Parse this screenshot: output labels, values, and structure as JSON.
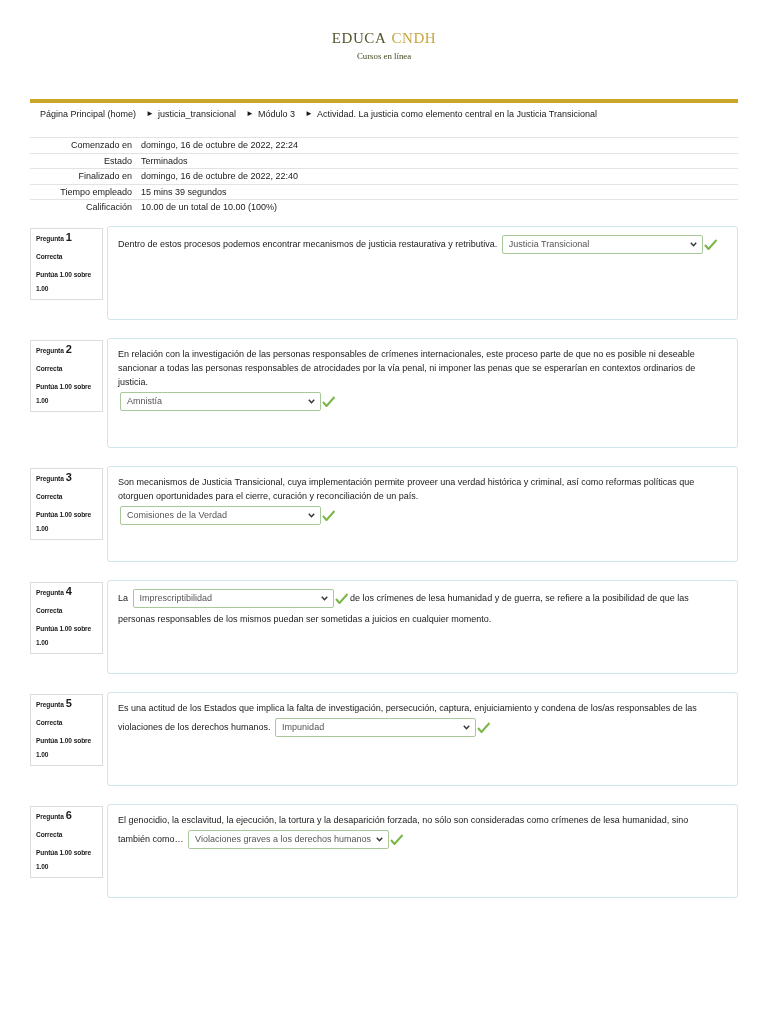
{
  "header": {
    "title": [
      {
        "kind": "primary",
        "text": "EDUCA"
      },
      {
        "kind": "accent",
        "text": "CNDH"
      }
    ],
    "subtitle": "Cursos en línea"
  },
  "breadcrumb": [
    {
      "text": "Página Principal (home)"
    },
    {
      "separator": "►",
      "text": "justicia_transicional"
    },
    {
      "separator": "►",
      "text": "Módulo 3"
    },
    {
      "separator": "►",
      "text": "Actividad. La justicia como elemento central en la Justicia Transicional"
    }
  ],
  "summary": [
    {
      "label": "Comenzado en",
      "value": "domingo, 16 de octubre de 2022, 22:24"
    },
    {
      "label": "Estado",
      "value": "Terminados"
    },
    {
      "label": "Finalizado en",
      "value": "domingo, 16 de octubre de 2022, 22:40"
    },
    {
      "label": "Tiempo empleado",
      "value": "15 mins 39 segundos"
    },
    {
      "label": "Calificación",
      "value": "10.00 de un total de 10.00 (100%)"
    }
  ],
  "questions": [
    {
      "label": "Pregunta",
      "number": "1",
      "status": "Correcta",
      "grade": "Puntúa 1.00 sobre 1.00",
      "parts": [
        {
          "kind": "text",
          "text": "Dentro de estos procesos podemos encontrar mecanismos de justicia restaurativa y retributiva."
        },
        {
          "kind": "answer",
          "value": "Justicia Transicional",
          "correct": true
        }
      ]
    },
    {
      "label": "Pregunta",
      "number": "2",
      "status": "Correcta",
      "grade": "Puntúa 1.00 sobre 1.00",
      "parts": [
        {
          "kind": "paragraph",
          "text": "En relación con la investigación de las personas responsables de crímenes internacionales, este proceso parte de que no es posible ni deseable sancionar a todas las personas responsables de atrocidades por la vía penal, ni imponer las penas que se esperarían en contextos ordinarios de justicia."
        },
        {
          "kind": "answer",
          "value": "Amnistía",
          "correct": true
        }
      ]
    },
    {
      "label": "Pregunta",
      "number": "3",
      "status": "Correcta",
      "grade": "Puntúa 1.00 sobre 1.00",
      "parts": [
        {
          "kind": "paragraph",
          "text": "Son mecanismos de Justicia Transicional, cuya implementación permite proveer una verdad histórica y criminal, así como reformas políticas que otorguen oportunidades para el cierre, curación y reconciliación de un país."
        },
        {
          "kind": "answer",
          "value": "Comisiones de la Verdad",
          "correct": true
        }
      ]
    },
    {
      "label": "Pregunta",
      "number": "4",
      "status": "Correcta",
      "grade": "Puntúa 1.00 sobre 1.00",
      "parts": [
        {
          "kind": "text",
          "text": "La"
        },
        {
          "kind": "answer",
          "value": "Imprescriptibilidad",
          "correct": true
        },
        {
          "kind": "text",
          "text": "de los crímenes de lesa humanidad y de guerra, se refiere a la posibilidad de que las"
        },
        {
          "kind": "paragraph",
          "text": "personas responsables de los mismos puedan ser sometidas a juicios en cualquier momento."
        }
      ]
    },
    {
      "label": "Pregunta",
      "number": "5",
      "status": "Correcta",
      "grade": "Puntúa 1.00 sobre 1.00",
      "parts": [
        {
          "kind": "paragraph",
          "text": "Es una actitud de los Estados que implica la falta de investigación, persecución, captura, enjuiciamiento y condena de los/as responsables de las"
        },
        {
          "kind": "text",
          "text": "violaciones de los derechos humanos."
        },
        {
          "kind": "answer",
          "value": "Impunidad",
          "correct": true
        }
      ]
    },
    {
      "label": "Pregunta",
      "number": "6",
      "status": "Correcta",
      "grade": "Puntúa 1.00 sobre 1.00",
      "parts": [
        {
          "kind": "paragraph",
          "text": "El genocidio, la esclavitud, la ejecución, la tortura y la desaparición forzada, no sólo son consideradas como crímenes de lesa humanidad, sino"
        },
        {
          "kind": "text",
          "text": "también como…"
        },
        {
          "kind": "answer",
          "value": "Violaciones graves a los derechos humanos",
          "correct": true
        }
      ]
    }
  ]
}
